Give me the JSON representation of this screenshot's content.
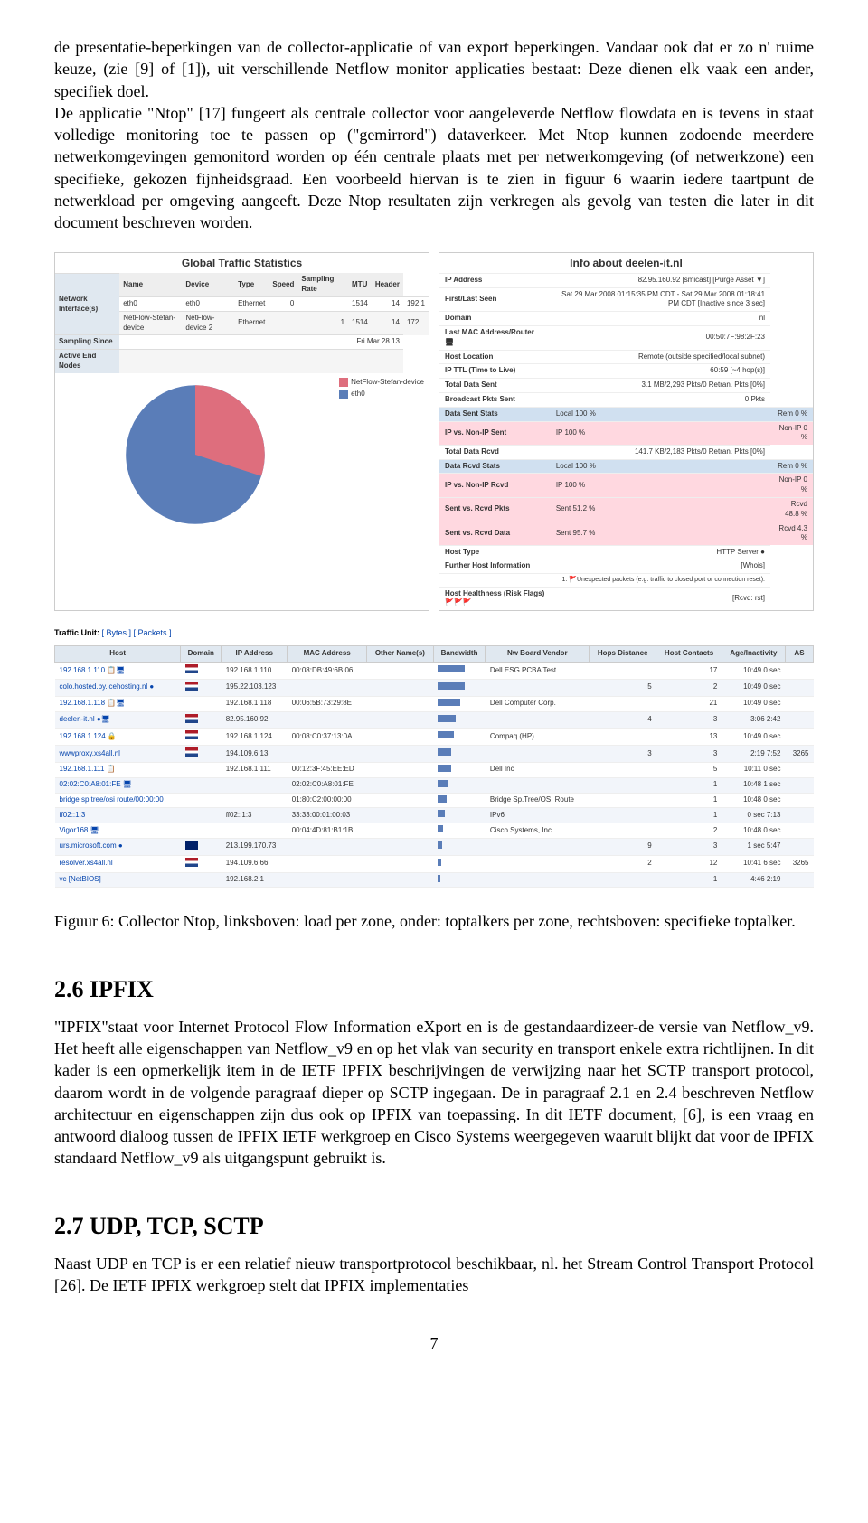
{
  "intro_para": "de presentatie-beperkingen van de collector-applicatie of van export beperkingen. Vandaar ook dat er zo n' ruime keuze, (zie [9] of [1]), uit verschillende Netflow monitor applicaties bestaat: Deze dienen elk vaak een ander, specifiek doel.",
  "intro_para2": "De applicatie \"Ntop\" [17] fungeert als centrale collector voor aangeleverde Netflow flowdata en is tevens in staat volledige monitoring toe te passen op (\"gemirrord\") dataverkeer. Met Ntop kunnen zodoende meerdere netwerkomgevingen gemonitord worden op één centrale plaats met per netwerkomgeving (of netwerkzone) een specifieke, gekozen fijnheidsgraad. Een voorbeeld hiervan is te zien in figuur 6 waarin iedere taartpunt de netwerkload per omgeving aangeeft. Deze Ntop resultaten zijn verkregen als gevolg van testen die later in dit document beschreven worden.",
  "global_title": "Global Traffic Statistics",
  "info_title": "Info about deelen-it.nl",
  "net_headers": [
    "Name",
    "Device",
    "Type",
    "Speed",
    "Sampling Rate",
    "MTU",
    "Header"
  ],
  "net_rows": [
    [
      "eth0",
      "eth0",
      "Ethernet",
      "0",
      "",
      "1514",
      "14",
      "192.1"
    ],
    [
      "NetFlow-Stefan-device",
      "NetFlow-device 2",
      "Ethernet",
      "",
      "1",
      "1514",
      "14",
      "172."
    ]
  ],
  "ni_label": "Network Interface(s)",
  "sampling_label": "Sampling Since",
  "sampling_val": "Fri Mar 28 13",
  "active_label": "Active End Nodes",
  "legend1": "NetFlow-Stefan-device",
  "legend2": "eth0",
  "info_rows": [
    {
      "k": "IP Address",
      "v": "82.95.160.92 [smicast] [Purge Asset ▼]"
    },
    {
      "k": "First/Last Seen",
      "v": "Sat 29 Mar 2008 01:15:35 PM CDT - Sat 29 Mar 2008 01:18:41 PM CDT [Inactive since 3 sec]"
    },
    {
      "k": "Domain",
      "v": "nl"
    },
    {
      "k": "Last MAC Address/Router 🖥",
      "v": "00:50:7F:98:2F:23"
    },
    {
      "k": "Host Location",
      "v": "Remote (outside specified/local subnet)"
    },
    {
      "k": "IP TTL (Time to Live)",
      "v": "60:59 [~4 hop(s)]"
    },
    {
      "k": "Total Data Sent",
      "v": "3.1 MB/2,293 Pkts/0 Retran. Pkts [0%]"
    },
    {
      "k": "Broadcast Pkts Sent",
      "v": "0 Pkts"
    },
    {
      "k": "Data Sent Stats",
      "v": "Local 100 %",
      "r": "Rem 0 %",
      "cls": "blue"
    },
    {
      "k": "IP vs. Non-IP Sent",
      "v": "IP 100 %",
      "r": "Non-IP 0 %",
      "cls": "pink"
    },
    {
      "k": "Total Data Rcvd",
      "v": "141.7 KB/2,183 Pkts/0 Retran. Pkts [0%]"
    },
    {
      "k": "Data Rcvd Stats",
      "v": "Local 100 %",
      "r": "Rem 0 %",
      "cls": "blue"
    },
    {
      "k": "IP vs. Non-IP Rcvd",
      "v": "IP 100 %",
      "r": "Non-IP 0 %",
      "cls": "pink"
    },
    {
      "k": "Sent vs. Rcvd Pkts",
      "v": "Sent 51.2 %",
      "r": "Rcvd 48.8 %",
      "cls": "pink"
    },
    {
      "k": "Sent vs. Rcvd Data",
      "v": "Sent 95.7 %",
      "r": "Rcvd 4.3 %",
      "cls": "pink"
    },
    {
      "k": "Host Type",
      "v": "HTTP Server ●"
    },
    {
      "k": "Further Host Information",
      "v": "[Whois]"
    },
    {
      "k": "",
      "v": "1. 🚩Unexpected packets (e.g. traffic to closed port or connection reset).",
      "sm": true
    },
    {
      "k": "Host Healthness (Risk Flags) 🚩🚩🚩",
      "v": "[Rcvd: rst]"
    }
  ],
  "traffic_unit_label": "Traffic Unit: ",
  "traffic_bytes": "[ Bytes ]",
  "traffic_packets": "[ Packets ]",
  "host_headers": [
    "Host",
    "Domain",
    "IP Address",
    "MAC Address",
    "Other Name(s)",
    "Bandwidth",
    "Nw Board Vendor",
    "Hops Distance",
    "Host Contacts",
    "Age/Inactivity",
    "AS"
  ],
  "host_rows": [
    {
      "h": "192.168.1.110 📋🖥",
      "d": "nl",
      "ip": "192.168.1.110",
      "mac": "00:08:DB:49:6B:06",
      "bw": 30,
      "v": "Dell ESG PCBA Test",
      "hd": "",
      "hc": "17",
      "age": "10:49  0 sec",
      "as": ""
    },
    {
      "h": "colo.hosted.by.icehosting.nl ●",
      "d": "nl",
      "ip": "195.22.103.123",
      "mac": "",
      "bw": 30,
      "v": "",
      "hd": "5",
      "hc": "2",
      "age": "10:49  0 sec",
      "as": ""
    },
    {
      "h": "192.168.1.118 📋🖥",
      "d": "",
      "ip": "192.168.1.118",
      "mac": "00:06:5B:73:29:8E",
      "bw": 25,
      "v": "Dell Computer Corp.",
      "hd": "",
      "hc": "21",
      "age": "10:49  0 sec",
      "as": ""
    },
    {
      "h": "deelen-it.nl ●🖥",
      "d": "nl",
      "ip": "82.95.160.92",
      "mac": "",
      "bw": 20,
      "v": "",
      "hd": "4",
      "hc": "3",
      "age": "3:06  2:42",
      "as": ""
    },
    {
      "h": "192.168.1.124 🔒",
      "d": "nl",
      "ip": "192.168.1.124",
      "mac": "00:08:C0:37:13:0A",
      "bw": 18,
      "v": "Compaq (HP)",
      "hd": "",
      "hc": "13",
      "age": "10:49  0 sec",
      "as": ""
    },
    {
      "h": "wwwproxy.xs4all.nl",
      "d": "nl",
      "ip": "194.109.6.13",
      "mac": "",
      "bw": 15,
      "v": "",
      "hd": "3",
      "hc": "3",
      "age": "2:19  7:52",
      "as": "3265"
    },
    {
      "h": "192.168.1.111 📋",
      "d": "",
      "ip": "192.168.1.111",
      "mac": "00:12:3F:45:EE:ED",
      "bw": 15,
      "v": "Dell Inc",
      "hd": "",
      "hc": "5",
      "age": "10:11  0 sec",
      "as": ""
    },
    {
      "h": "02:02:C0:A8:01:FE 🖥",
      "d": "",
      "ip": "",
      "mac": "02:02:C0:A8:01:FE",
      "bw": 12,
      "v": "",
      "hd": "",
      "hc": "1",
      "age": "10:48  1 sec",
      "as": ""
    },
    {
      "h": "bridge sp.tree/osi route/00:00:00",
      "d": "",
      "ip": "",
      "mac": "01:80:C2:00:00:00",
      "bw": 10,
      "v": "Bridge Sp.Tree/OSI Route",
      "hd": "",
      "hc": "1",
      "age": "10:48  0 sec",
      "as": ""
    },
    {
      "h": "ff02::1:3",
      "d": "",
      "ip": "ff02::1:3",
      "mac": "33:33:00:01:00:03",
      "bw": 8,
      "v": "IPv6",
      "hd": "",
      "hc": "1",
      "age": "0 sec  7:13",
      "as": ""
    },
    {
      "h": "Vigor168 🖥",
      "d": "",
      "ip": "",
      "mac": "00:04:4D:81:B1:1B",
      "bw": 6,
      "v": "Cisco Systems, Inc.",
      "hd": "",
      "hc": "2",
      "age": "10:48  0 sec",
      "as": ""
    },
    {
      "h": "urs.microsoft.com ●",
      "d": "uk",
      "ip": "213.199.170.73",
      "mac": "",
      "bw": 5,
      "v": "",
      "hd": "9",
      "hc": "3",
      "age": "1 sec  5:47",
      "as": ""
    },
    {
      "h": "resolver.xs4all.nl",
      "d": "nl",
      "ip": "194.109.6.66",
      "mac": "",
      "bw": 4,
      "v": "",
      "hd": "2",
      "hc": "12",
      "age": "10:41  6 sec",
      "as": "3265"
    },
    {
      "h": "vc [NetBIOS]",
      "d": "",
      "ip": "192.168.2.1",
      "mac": "",
      "bw": 3,
      "v": "",
      "hd": "",
      "hc": "1",
      "age": "4:46  2:19",
      "as": ""
    }
  ],
  "caption": "Figuur 6: Collector Ntop, linksboven: load per zone, onder: toptalkers per zone, rechtsboven: specifieke toptalker.",
  "h26": "2.6   IPFIX",
  "p26": "\"IPFIX\"staat voor Internet Protocol Flow Information eXport en is de gestandaardizeer-de versie van Netflow_v9. Het heeft alle eigenschappen van Netflow_v9 en op het vlak van security en transport enkele extra richtlijnen. In dit kader is een opmerkelijk item in de IETF IPFIX beschrijvingen de verwijzing naar het SCTP transport protocol, daarom wordt in de volgende paragraaf dieper op SCTP ingegaan. De in paragraaf 2.1 en 2.4 beschreven Netflow architectuur en eigenschappen zijn dus ook op IPFIX van toepassing. In dit IETF document, [6], is een vraag en antwoord dialoog tussen de IPFIX IETF werkgroep en Cisco Systems weergegeven waaruit blijkt dat voor de IPFIX standaard Netflow_v9 als uitgangspunt gebruikt is.",
  "h27": "2.7   UDP, TCP, SCTP",
  "p27": "Naast UDP en TCP is er een relatief nieuw transportprotocol beschikbaar, nl. het Stream Control Transport Protocol [26]. De IETF IPFIX werkgroep stelt dat IPFIX implementaties",
  "page": "7",
  "chart_data": {
    "type": "pie",
    "title": "Active End Nodes",
    "series": [
      {
        "name": "NetFlow-Stefan-device",
        "value": 40,
        "color": "#de6e7d"
      },
      {
        "name": "eth0",
        "value": 60,
        "color": "#5a7db8"
      }
    ]
  }
}
